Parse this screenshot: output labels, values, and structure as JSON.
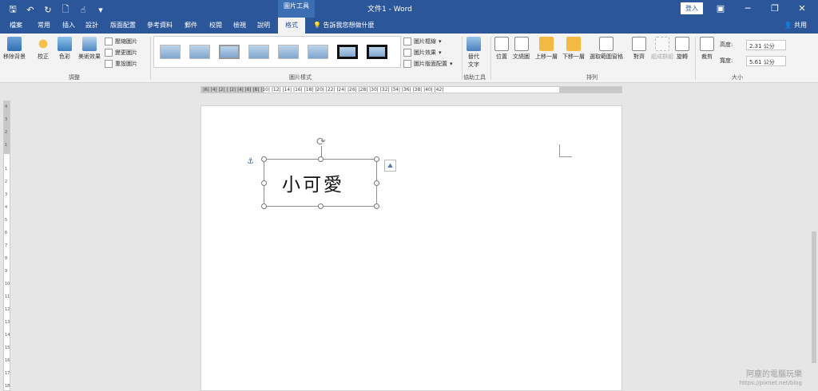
{
  "title_bar": {
    "document_title": "文件1 - Word",
    "context_label": "圖片工具",
    "signin_label": "登入"
  },
  "tabs": [
    {
      "label": "檔案"
    },
    {
      "label": "常用"
    },
    {
      "label": "插入"
    },
    {
      "label": "設計"
    },
    {
      "label": "版面配置"
    },
    {
      "label": "參考資料"
    },
    {
      "label": "郵件"
    },
    {
      "label": "校閱"
    },
    {
      "label": "檢視"
    },
    {
      "label": "說明"
    },
    {
      "label": "格式"
    }
  ],
  "tell_me": "告訴我您想做什麼",
  "share_label": "共用",
  "ribbon": {
    "adjust": {
      "remove_bg": "移除背景",
      "corrections": "校正",
      "color": "色彩",
      "artistic": "美術效果",
      "compress": "壓縮圖片",
      "change": "變更圖片",
      "reset": "重設圖片",
      "label": "調整"
    },
    "styles": {
      "border": "圖片框線",
      "effects": "圖片效果",
      "layout": "圖片版面配置",
      "label": "圖片樣式"
    },
    "accessibility": {
      "alt_text_1": "替代",
      "alt_text_2": "文字",
      "label": "協助工具"
    },
    "arrange": {
      "position": "位置",
      "wrap": "文繞圖",
      "forward": "上移一層",
      "backward": "下移一層",
      "selection": "選取範圍窗格",
      "align": "對齊",
      "group": "組成群組",
      "rotate": "旋轉",
      "label": "排列"
    },
    "size": {
      "crop": "裁剪",
      "height_label": "高度:",
      "height_value": "2.31 公分",
      "width_label": "寬度:",
      "width_value": "5.61 公分",
      "label": "大小"
    }
  },
  "ruler_text": "|6| |4| |2| | |2| |4| |6| |8| |10| |12| |14| |16| |18| |20| |22| |24| |26| |28| |30| |32| |34| |36| |38| |40| |42|",
  "vertical_ruler": [
    "4",
    "3",
    "2",
    "1",
    "1",
    "2",
    "3",
    "4",
    "5",
    "6",
    "7",
    "8",
    "9",
    "10",
    "11",
    "12",
    "13",
    "14",
    "15",
    "16",
    "17",
    "18"
  ],
  "document": {
    "image_text": "小可愛"
  },
  "watermark": {
    "line1": "阿塵的電腦玩樂",
    "line2": "https://pixnet.net/blog"
  }
}
